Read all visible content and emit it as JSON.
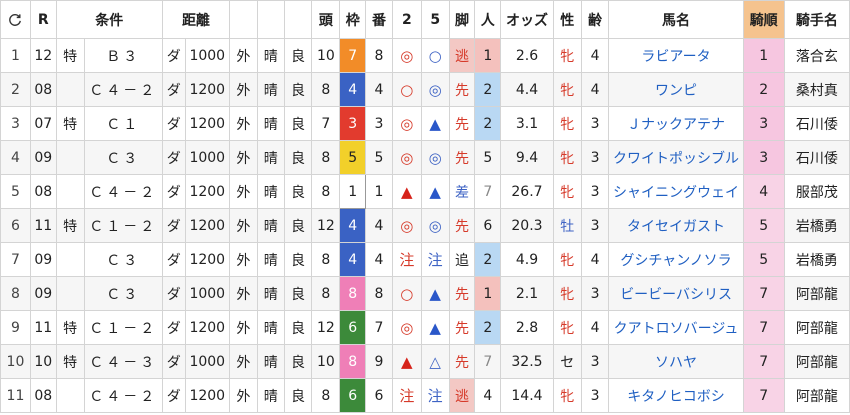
{
  "headers": {
    "reload": "↻",
    "r": "R",
    "cond": "条件",
    "dist": "距離",
    "heads": "頭",
    "waku": "枠",
    "ban": "番",
    "two": "2",
    "five": "5",
    "ashi": "脚",
    "ninki": "人",
    "odds": "オッズ",
    "sex": "性",
    "age": "齢",
    "horse": "馬名",
    "kijun": "騎順",
    "jockey": "騎手名"
  },
  "colors": {
    "header_kijun": "#f5c38e",
    "kijun_cell": "#f6c6e0",
    "waku": {
      "1": "#ffffff",
      "3": "#e23b2e",
      "4": "#3a62c4",
      "5": "#f2d02a",
      "6": "#3c8a3a",
      "7": "#f28c28",
      "8": "#ef7fb7"
    },
    "ninki_1": "#f4c1bd",
    "ninki_2": "#b9d8f3",
    "ashi_highlight": "#f3c8c4",
    "horse_name": "#1f5fc2"
  },
  "rows": [
    {
      "no": "1",
      "r": "12",
      "toku": "特",
      "cls": "Ｂ３",
      "track": "ダ",
      "dist": "1000",
      "course": "外",
      "weather": "晴",
      "cond": "良",
      "heads": "10",
      "waku": "7",
      "ban": "8",
      "m2": "◎",
      "m2c": "mk-dbl",
      "m5": "○",
      "m5c": "mk-circ-blue",
      "ashi": "逃",
      "ashic": "ashi-red",
      "ashi_hl": true,
      "ninki": "1",
      "ninki_hl": "1",
      "odds": "2.6",
      "sex": "牝",
      "sexc": "sex-red",
      "age": "4",
      "horse": "ラビアータ",
      "kijun": "1",
      "kijun_hl": true,
      "jockey": "落合玄"
    },
    {
      "no": "2",
      "r": "08",
      "toku": "",
      "cls": "Ｃ４－２",
      "track": "ダ",
      "dist": "1200",
      "course": "外",
      "weather": "晴",
      "cond": "良",
      "heads": "8",
      "waku": "4",
      "ban": "4",
      "m2": "○",
      "m2c": "mk-circ",
      "m5": "◎",
      "m5c": "mk-circ-blue",
      "ashi": "先",
      "ashic": "ashi-red",
      "ashi_hl": false,
      "ninki": "2",
      "ninki_hl": "2",
      "odds": "4.4",
      "sex": "牝",
      "sexc": "sex-red",
      "age": "4",
      "horse": "ワンピ",
      "kijun": "2",
      "kijun_hl": true,
      "jockey": "桑村真"
    },
    {
      "no": "3",
      "r": "07",
      "toku": "特",
      "cls": "Ｃ１",
      "track": "ダ",
      "dist": "1200",
      "course": "外",
      "weather": "晴",
      "cond": "良",
      "heads": "7",
      "waku": "3",
      "ban": "3",
      "m2": "◎",
      "m2c": "mk-dbl",
      "m5": "▲",
      "m5c": "mk-tri-blue",
      "ashi": "先",
      "ashic": "ashi-red",
      "ashi_hl": false,
      "ninki": "2",
      "ninki_hl": "2",
      "odds": "3.1",
      "sex": "牝",
      "sexc": "sex-red",
      "age": "3",
      "horse": "Ｊナックアテナ",
      "kijun": "3",
      "kijun_hl": true,
      "jockey": "石川倭"
    },
    {
      "no": "4",
      "r": "09",
      "toku": "",
      "cls": "Ｃ３",
      "track": "ダ",
      "dist": "1000",
      "course": "外",
      "weather": "晴",
      "cond": "良",
      "heads": "8",
      "waku": "5",
      "ban": "5",
      "m2": "◎",
      "m2c": "mk-dbl",
      "m5": "◎",
      "m5c": "mk-circ-blue",
      "ashi": "先",
      "ashic": "ashi-red",
      "ashi_hl": false,
      "ninki": "5",
      "ninki_hl": "",
      "odds": "9.4",
      "sex": "牝",
      "sexc": "sex-red",
      "age": "3",
      "horse": "クワイトポッシブル",
      "kijun": "3",
      "kijun_hl": true,
      "jockey": "石川倭"
    },
    {
      "no": "5",
      "r": "08",
      "toku": "",
      "cls": "Ｃ４－２",
      "track": "ダ",
      "dist": "1200",
      "course": "外",
      "weather": "晴",
      "cond": "良",
      "heads": "8",
      "waku": "1",
      "ban": "1",
      "m2": "▲",
      "m2c": "mk-tri-red",
      "m5": "▲",
      "m5c": "mk-tri-blue",
      "ashi": "差",
      "ashic": "ashi-blue",
      "ashi_hl": false,
      "ninki": "7",
      "ninki_hl": "muted",
      "odds": "26.7",
      "sex": "牝",
      "sexc": "sex-red",
      "age": "3",
      "horse": "シャイニングウェイ",
      "kijun": "4",
      "kijun_hl": false,
      "jockey": "服部茂"
    },
    {
      "no": "6",
      "r": "11",
      "toku": "特",
      "cls": "Ｃ１－２",
      "track": "ダ",
      "dist": "1200",
      "course": "外",
      "weather": "晴",
      "cond": "良",
      "heads": "12",
      "waku": "4",
      "ban": "4",
      "m2": "◎",
      "m2c": "mk-dbl",
      "m5": "◎",
      "m5c": "mk-circ-blue",
      "ashi": "先",
      "ashic": "ashi-red",
      "ashi_hl": false,
      "ninki": "6",
      "ninki_hl": "",
      "odds": "20.3",
      "sex": "牡",
      "sexc": "sex-blue",
      "age": "3",
      "horse": "タイセイガスト",
      "kijun": "5",
      "kijun_hl": false,
      "jockey": "岩橋勇"
    },
    {
      "no": "7",
      "r": "09",
      "toku": "",
      "cls": "Ｃ３",
      "track": "ダ",
      "dist": "1200",
      "course": "外",
      "weather": "晴",
      "cond": "良",
      "heads": "8",
      "waku": "4",
      "ban": "4",
      "m2": "注",
      "m2c": "mk-chu-red",
      "m5": "注",
      "m5c": "mk-chu-blue",
      "ashi": "追",
      "ashic": "ashi-dark",
      "ashi_hl": false,
      "ninki": "2",
      "ninki_hl": "2",
      "odds": "4.9",
      "sex": "牝",
      "sexc": "sex-red",
      "age": "4",
      "horse": "グシチャンノソラ",
      "kijun": "5",
      "kijun_hl": false,
      "jockey": "岩橋勇"
    },
    {
      "no": "8",
      "r": "09",
      "toku": "",
      "cls": "Ｃ３",
      "track": "ダ",
      "dist": "1000",
      "course": "外",
      "weather": "晴",
      "cond": "良",
      "heads": "8",
      "waku": "8",
      "ban": "8",
      "m2": "○",
      "m2c": "mk-circ",
      "m5": "▲",
      "m5c": "mk-tri-blue",
      "ashi": "先",
      "ashic": "ashi-red",
      "ashi_hl": false,
      "ninki": "1",
      "ninki_hl": "1",
      "odds": "2.1",
      "sex": "牝",
      "sexc": "sex-red",
      "age": "3",
      "horse": "ビービーバシリス",
      "kijun": "7",
      "kijun_hl": false,
      "jockey": "阿部龍"
    },
    {
      "no": "9",
      "r": "11",
      "toku": "特",
      "cls": "Ｃ１－２",
      "track": "ダ",
      "dist": "1200",
      "course": "外",
      "weather": "晴",
      "cond": "良",
      "heads": "12",
      "waku": "6",
      "ban": "7",
      "m2": "◎",
      "m2c": "mk-dbl",
      "m5": "▲",
      "m5c": "mk-tri-blue",
      "ashi": "先",
      "ashic": "ashi-red",
      "ashi_hl": false,
      "ninki": "2",
      "ninki_hl": "2",
      "odds": "2.8",
      "sex": "牝",
      "sexc": "sex-red",
      "age": "4",
      "horse": "クアトロソバージュ",
      "kijun": "7",
      "kijun_hl": false,
      "jockey": "阿部龍"
    },
    {
      "no": "10",
      "r": "10",
      "toku": "特",
      "cls": "Ｃ４－３",
      "track": "ダ",
      "dist": "1000",
      "course": "外",
      "weather": "晴",
      "cond": "良",
      "heads": "10",
      "waku": "8",
      "ban": "9",
      "m2": "▲",
      "m2c": "mk-tri-red",
      "m5": "△",
      "m5c": "mk-tri-out",
      "ashi": "先",
      "ashic": "ashi-red",
      "ashi_hl": false,
      "ninki": "7",
      "ninki_hl": "muted",
      "odds": "32.5",
      "sex": "セ",
      "sexc": "sex-dark",
      "age": "3",
      "horse": "ソハヤ",
      "kijun": "7",
      "kijun_hl": false,
      "jockey": "阿部龍"
    },
    {
      "no": "11",
      "r": "08",
      "toku": "",
      "cls": "Ｃ４－２",
      "track": "ダ",
      "dist": "1200",
      "course": "外",
      "weather": "晴",
      "cond": "良",
      "heads": "8",
      "waku": "6",
      "ban": "6",
      "m2": "注",
      "m2c": "mk-chu-red",
      "m5": "注",
      "m5c": "mk-chu-blue",
      "ashi": "逃",
      "ashic": "ashi-red",
      "ashi_hl": true,
      "ninki": "4",
      "ninki_hl": "",
      "odds": "14.4",
      "sex": "牝",
      "sexc": "sex-red",
      "age": "3",
      "horse": "キタノヒコボシ",
      "kijun": "7",
      "kijun_hl": false,
      "jockey": "阿部龍"
    }
  ]
}
